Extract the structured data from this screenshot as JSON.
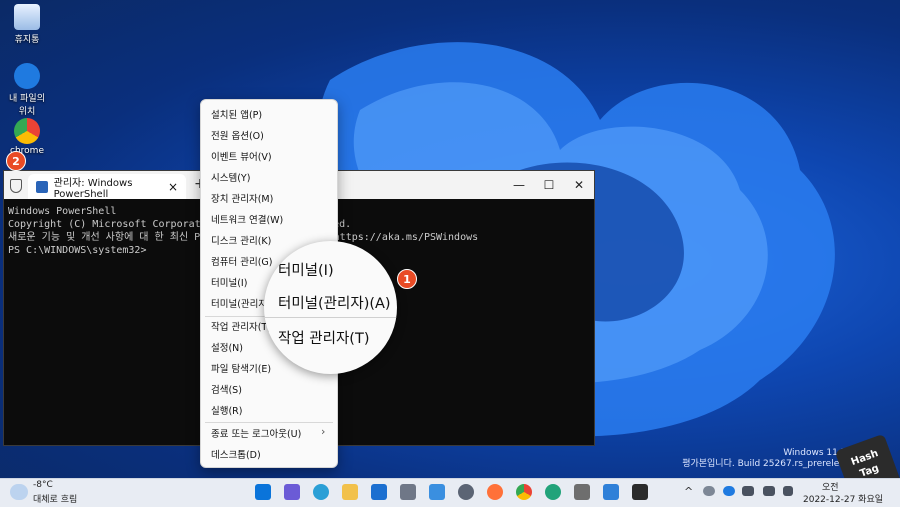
{
  "desktop": {
    "icons": [
      {
        "label": "휴지통",
        "icon": "recycle-bin-icon"
      },
      {
        "label": "내 파일의\n위치",
        "icon": "onedrive-icon"
      },
      {
        "label": "chrome",
        "icon": "chrome-icon"
      }
    ]
  },
  "terminal": {
    "tab_title": "관리자: Windows PowerShell",
    "lines": [
      "Windows PowerShell",
      "Copyright (C) Microsoft Corporation. All rights reserved.",
      "",
      "새로운 기능 및 개선 사항에 대 한 최신 PowerShell을 설치 하세요! https://aka.ms/PSWindows",
      "",
      "PS C:\\WINDOWS\\system32>"
    ],
    "new_tab_symbol": "+",
    "close_tab_symbol": "×",
    "dropdown_symbol": "⌄",
    "minimize_symbol": "—",
    "maximize_symbol": "☐",
    "close_symbol": "✕"
  },
  "context_menu": {
    "items": [
      "설치된 앱(P)",
      "전원 옵션(O)",
      "이벤트 뷰어(V)",
      "시스템(Y)",
      "장치 관리자(M)",
      "네트워크 연결(W)",
      "디스크 관리(K)",
      "컴퓨터 관리(G)",
      "터미널(I)",
      "터미널(관리자)(A)",
      "작업 관리자(T)",
      "설정(N)",
      "파일 탐색기(E)",
      "검색(S)",
      "실행(R)",
      "종료 또는 로그아웃(U)",
      "데스크톱(D)"
    ],
    "submenu_arrow": "›"
  },
  "magnifier": {
    "items": [
      "터미널(I)",
      "터미널(관리자)(A)",
      "작업 관리자(T)"
    ]
  },
  "badges": {
    "step1": "1",
    "step2": "2"
  },
  "watermark": {
    "line1": "Windows 11 Pro",
    "line2": "평가본입니다. Build 25267.rs_prerelease"
  },
  "taskbar": {
    "weather_temp": "-8°C",
    "weather_desc": "대체로 흐림",
    "time": "오전",
    "date": "2022-12-27 화요일",
    "tray_arrow": "^"
  },
  "brand": {
    "text1": "Hash",
    "text2": "Tag"
  },
  "colors": {
    "badge": "#e94b25",
    "terminal_bg": "#0c0c0c",
    "accent": "#0067c0"
  }
}
